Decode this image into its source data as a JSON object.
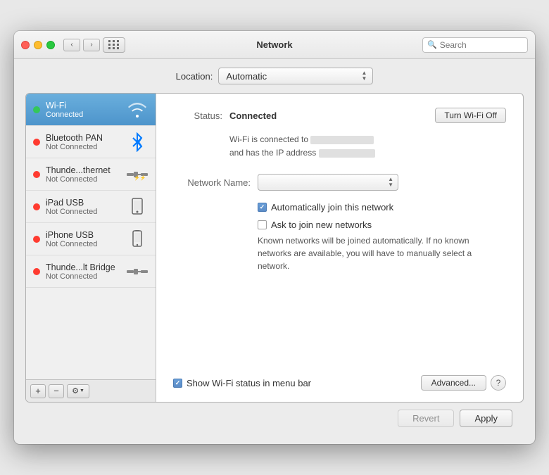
{
  "window": {
    "title": "Network"
  },
  "titlebar": {
    "title": "Network",
    "search_placeholder": "Search"
  },
  "location": {
    "label": "Location:",
    "value": "Automatic"
  },
  "sidebar": {
    "items": [
      {
        "id": "wifi",
        "name": "Wi-Fi",
        "status": "Connected",
        "status_color": "green",
        "active": true,
        "icon": "wifi"
      },
      {
        "id": "bluetooth-pan",
        "name": "Bluetooth PAN",
        "status": "Not Connected",
        "status_color": "red",
        "active": false,
        "icon": "bluetooth"
      },
      {
        "id": "thunderbolt-ethernet",
        "name": "Thunde...thernet",
        "status": "Not Connected",
        "status_color": "red",
        "active": false,
        "icon": "thunderbolt"
      },
      {
        "id": "ipad-usb",
        "name": "iPad USB",
        "status": "Not Connected",
        "status_color": "red",
        "active": false,
        "icon": "ipad"
      },
      {
        "id": "iphone-usb",
        "name": "iPhone USB",
        "status": "Not Connected",
        "status_color": "red",
        "active": false,
        "icon": "iphone"
      },
      {
        "id": "thunderbolt-bridge",
        "name": "Thunde...lt Bridge",
        "status": "Not Connected",
        "status_color": "red",
        "active": false,
        "icon": "thunderbolt"
      }
    ],
    "toolbar": {
      "add_label": "+",
      "remove_label": "−",
      "gear_label": "⚙"
    }
  },
  "detail": {
    "status_label": "Status:",
    "status_value": "Connected",
    "wifi_line1_prefix": "Wi-Fi is connected to",
    "wifi_line2_prefix": "and has the IP address",
    "turn_wifi_off_label": "Turn Wi-Fi Off",
    "network_name_label": "Network Name:",
    "auto_join_label": "Automatically join this network",
    "auto_join_checked": true,
    "ask_join_label": "Ask to join new networks",
    "ask_join_checked": false,
    "known_networks_text": "Known networks will be joined automatically. If no known networks are available, you will have to manually select a network.",
    "show_wifi_label": "Show Wi-Fi status in menu bar",
    "show_wifi_checked": true,
    "advanced_label": "Advanced...",
    "help_label": "?"
  },
  "footer": {
    "revert_label": "Revert",
    "apply_label": "Apply"
  }
}
